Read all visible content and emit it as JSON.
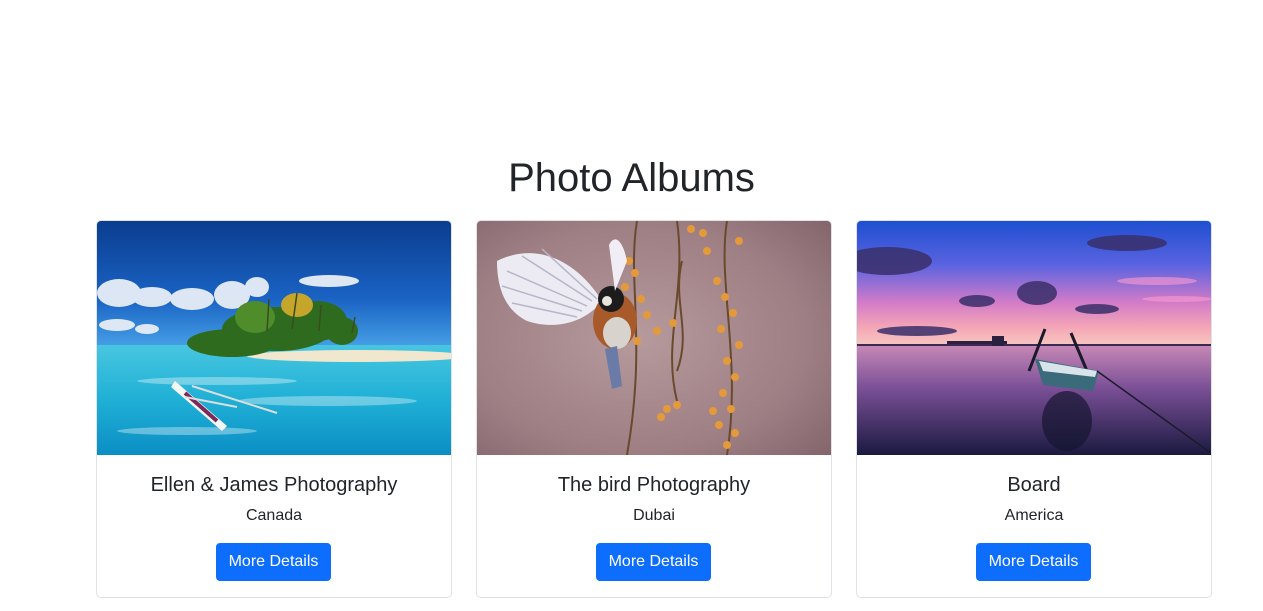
{
  "page": {
    "title": "Photo Albums"
  },
  "albums": [
    {
      "title": "Ellen & James Photography",
      "location": "Canada",
      "button_label": "More Details",
      "image": "tropical-island-photo"
    },
    {
      "title": "The bird Photography",
      "location": "Dubai",
      "button_label": "More Details",
      "image": "bird-branch-photo"
    },
    {
      "title": "Board",
      "location": "America",
      "button_label": "More Details",
      "image": "boat-sunset-photo"
    }
  ],
  "colors": {
    "button_bg": "#0d6efd",
    "text": "#212529",
    "card_border": "#dfe2e6"
  }
}
